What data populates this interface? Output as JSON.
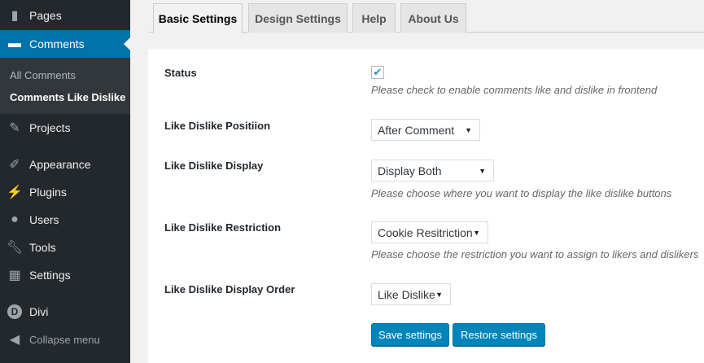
{
  "sidebar": {
    "items": [
      {
        "label": "Pages",
        "icon": "pages-icon"
      },
      {
        "label": "Comments",
        "icon": "comments-icon"
      },
      {
        "label": "Projects",
        "icon": "pin-icon"
      },
      {
        "label": "Appearance",
        "icon": "brush-icon"
      },
      {
        "label": "Plugins",
        "icon": "plug-icon"
      },
      {
        "label": "Users",
        "icon": "user-icon"
      },
      {
        "label": "Tools",
        "icon": "wrench-icon"
      },
      {
        "label": "Settings",
        "icon": "settings-icon"
      },
      {
        "label": "Divi",
        "icon": "divi-icon"
      }
    ],
    "submenu": [
      "All Comments",
      "Comments Like Dislike"
    ],
    "collapse": "Collapse menu"
  },
  "tabs": [
    "Basic Settings",
    "Design Settings",
    "Help",
    "About Us"
  ],
  "form": {
    "status": {
      "label": "Status",
      "checked": true,
      "help": "Please check to enable comments like and dislike in frontend"
    },
    "position": {
      "label": "Like Dislike Positiion",
      "value": "After Comment"
    },
    "display": {
      "label": "Like Dislike Display",
      "value": "Display Both",
      "help": "Please choose where you want to display the like dislike buttons"
    },
    "restriction": {
      "label": "Like Dislike Restriction",
      "value": "Cookie Resitriction",
      "help": "Please choose the restriction you want to assign to likers and dislikers"
    },
    "order": {
      "label": "Like Dislike Display Order",
      "value": "Like Dislike"
    },
    "save": "Save settings",
    "restore": "Restore settings"
  },
  "glyphs": {
    "check": "✔",
    "arrow": "▼"
  }
}
